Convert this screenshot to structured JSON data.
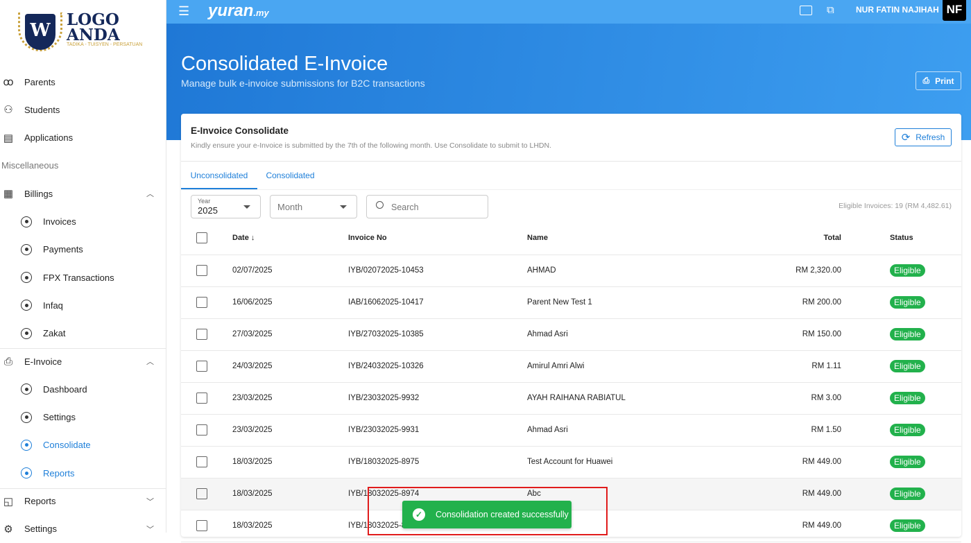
{
  "logo": {
    "line1": "LOGO",
    "line2": "ANDA",
    "tagline": "TADIKA - TUISYEN - PERSATUAN",
    "letter": "W"
  },
  "sidebar": {
    "items": [
      {
        "label": "Parents",
        "icon": "parents-icon",
        "type": "main"
      },
      {
        "label": "Students",
        "icon": "students-icon",
        "type": "main"
      },
      {
        "label": "Applications",
        "icon": "document-icon",
        "type": "main"
      },
      {
        "label": "Miscellaneous",
        "type": "section"
      },
      {
        "label": "Billings",
        "icon": "billing-icon",
        "type": "main",
        "chevron": "up"
      },
      {
        "label": "Invoices",
        "type": "sub"
      },
      {
        "label": "Payments",
        "type": "sub"
      },
      {
        "label": "FPX Transactions",
        "type": "sub"
      },
      {
        "label": "Infaq",
        "type": "sub"
      },
      {
        "label": "Zakat",
        "type": "sub"
      },
      {
        "label": "E-Invoice",
        "icon": "einvoice-icon",
        "type": "main",
        "chevron": "up"
      },
      {
        "label": "Dashboard",
        "type": "sub",
        "icon": "dashboard-icon"
      },
      {
        "label": "Settings",
        "type": "sub"
      },
      {
        "label": "Consolidate",
        "type": "sub",
        "active": true
      },
      {
        "label": "Reports",
        "type": "sub",
        "active": true
      },
      {
        "label": "Reports",
        "icon": "reports-icon",
        "type": "main",
        "chevron": "down"
      },
      {
        "label": "Settings",
        "icon": "settings-icon",
        "type": "main",
        "chevron": "down"
      }
    ]
  },
  "topbar": {
    "brand": "yuran",
    "brand_suffix": ".my",
    "user": "NUR FATIN NAJIHAH",
    "avatar": "NF"
  },
  "hero": {
    "title": "Consolidated E-Invoice",
    "subtitle": "Manage bulk e-invoice submissions for B2C transactions",
    "print_label": "Print"
  },
  "card": {
    "title": "E-Invoice Consolidate",
    "note": "Kindly ensure your e-Invoice is submitted by the 7th of the following month. Use Consolidate to submit to LHDN.",
    "refresh_label": "Refresh",
    "tabs": [
      "Unconsolidated",
      "Consolidated"
    ],
    "filters": {
      "year_label": "Year",
      "year_value": "2025",
      "month_placeholder": "Month",
      "search_placeholder": "Search"
    },
    "eligible_summary": "Eligible Invoices: 19 (RM 4,482.61)",
    "columns": [
      "Date",
      "Invoice No",
      "Name",
      "Total",
      "Status"
    ],
    "rows": [
      [
        "02/07/2025",
        "IYB/02072025-10453",
        "AHMAD",
        "RM 2,320.00",
        "Eligible"
      ],
      [
        "16/06/2025",
        "IAB/16062025-10417",
        "Parent New Test 1",
        "RM 200.00",
        "Eligible"
      ],
      [
        "27/03/2025",
        "IYB/27032025-10385",
        "Ahmad Asri",
        "RM 150.00",
        "Eligible"
      ],
      [
        "24/03/2025",
        "IYB/24032025-10326",
        "Amirul Amri Alwi",
        "RM 1.11",
        "Eligible"
      ],
      [
        "23/03/2025",
        "IYB/23032025-9932",
        "AYAH RAIHANA RABIATUL",
        "RM 3.00",
        "Eligible"
      ],
      [
        "23/03/2025",
        "IYB/23032025-9931",
        "Ahmad Asri",
        "RM 1.50",
        "Eligible"
      ],
      [
        "18/03/2025",
        "IYB/18032025-8975",
        "Test Account for Huawei",
        "RM 449.00",
        "Eligible"
      ],
      [
        "18/03/2025",
        "IYB/18032025-8974",
        "Abc",
        "RM 449.00",
        "Eligible"
      ],
      [
        "18/03/2025",
        "IYB/18032025-8",
        "",
        "RM 449.00",
        "Eligible"
      ]
    ]
  },
  "toast": {
    "message": "Consolidation created successfully"
  }
}
